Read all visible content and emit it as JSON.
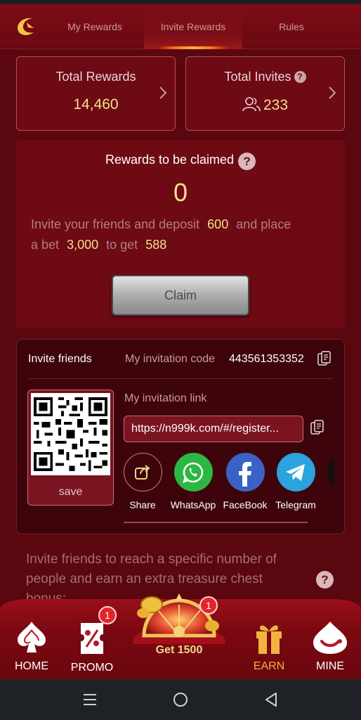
{
  "tabs": {
    "my_rewards": "My Rewards",
    "invite_rewards": "Invite Rewards",
    "rules": "Rules"
  },
  "summary": {
    "total_rewards_label": "Total Rewards",
    "total_rewards_value": "14,460",
    "total_invites_label": "Total Invites",
    "total_invites_value": "233"
  },
  "claim": {
    "title": "Rewards to be claimed",
    "amount": "0",
    "text1": "Invite your friends and deposit",
    "deposit": "600",
    "text2": "and place",
    "text3": "a bet",
    "bet": "3,000",
    "text4": "to get",
    "reward": "588",
    "button": "Claim"
  },
  "invite": {
    "invite_friends": "Invite friends",
    "code_label": "My invitation code",
    "code": "443561353352",
    "link_label": "My invitation link",
    "link": "https://n999k.com/#/register...",
    "save": "save",
    "share": [
      {
        "label": "Share",
        "icon": "share-icon"
      },
      {
        "label": "WhatsApp",
        "icon": "whatsapp-icon"
      },
      {
        "label": "FaceBook",
        "icon": "facebook-icon"
      },
      {
        "label": "Telegram",
        "icon": "telegram-icon"
      }
    ]
  },
  "chest": {
    "text": "Invite friends to reach a specific number of people and earn an extra treasure chest bonus:"
  },
  "nav": {
    "home": "HOME",
    "promo": "PROMO",
    "promo_badge": "1",
    "center": "Get 1500",
    "center_badge": "1",
    "earn": "EARN",
    "mine": "MINE"
  },
  "colors": {
    "background": "#5a0710",
    "accent_gold": "#f6e08a",
    "earn_active": "#f0b340",
    "panel": "#6d0a14"
  }
}
